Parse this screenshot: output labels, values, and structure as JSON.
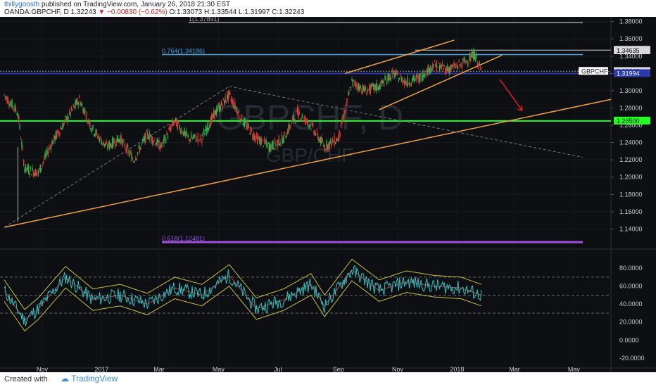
{
  "header": {
    "author": "thillygoosth",
    "published": "published on TradingView.com, January 26, 2018 21:30 EST",
    "symbol_line": "OANDA:GBPCHF, D  1.32243",
    "change": "−0.00830 (−0.62%)",
    "ohlc": "O:1.33073  H:1.33544  L:1.31997  C:1.32243"
  },
  "watermark": {
    "main": "GBPCHF, D",
    "sub": "GBP/CHF"
  },
  "colors": {
    "background": "#0d0f12",
    "bull": "#2db84a",
    "bear": "#e23a3a",
    "fib_blue": "#4a9fe0",
    "fib_gray": "#a0a0a0",
    "fib_purple": "#a050e0",
    "support_green": "#22ff22",
    "trend_orange": "#f0a040",
    "arrow_red": "#e02020",
    "rsi_line": "#30c0c0",
    "bands": "#c8c040"
  },
  "chart_data": {
    "type": "line",
    "title": "OANDA:GBPCHF, D",
    "price_axis": {
      "range": [
        1.12,
        1.383
      ],
      "ticks": [
        "1.38000",
        "1.36000",
        "1.34000",
        "1.32000",
        "1.30000",
        "1.28000",
        "1.26000",
        "1.24000",
        "1.22000",
        "1.20000",
        "1.18000",
        "1.16000",
        "1.14000"
      ]
    },
    "price_labels": [
      {
        "text": "1.34697",
        "value": 1.34697
      },
      {
        "text": "1.34635",
        "value": 1.34635
      },
      {
        "text": "GBPCHF",
        "value": 1.3225
      },
      {
        "text": "1.32243",
        "value": 1.32243
      },
      {
        "text": "1.31994",
        "value": 1.31994
      },
      {
        "text": "1.26500",
        "value": 1.265
      }
    ],
    "fib_levels": [
      {
        "label": "1(1.37891)",
        "value": 1.37891
      },
      {
        "label": "0.764(1.34186)",
        "value": 1.34186
      },
      {
        "label": "0.618(1.12481)",
        "value": 1.12481
      }
    ],
    "time_axis": [
      "Nov",
      "2017",
      "Mar",
      "May",
      "Jul",
      "Sep",
      "Nov",
      "2018",
      "Mar",
      "May"
    ],
    "series": [
      {
        "x": [
          "2016-09-23",
          "2016-10-07",
          "2016-10-14",
          "2016-10-28",
          "2016-11-11",
          "2016-11-25",
          "2016-12-09",
          "2016-12-23",
          "2017-01-06",
          "2017-01-20",
          "2017-02-03",
          "2017-02-17",
          "2017-03-03",
          "2017-03-17",
          "2017-03-31",
          "2017-04-14",
          "2017-04-28",
          "2017-05-12",
          "2017-05-26",
          "2017-06-09",
          "2017-06-23",
          "2017-07-07",
          "2017-07-21",
          "2017-08-04",
          "2017-08-18",
          "2017-09-01",
          "2017-09-15",
          "2017-09-29",
          "2017-10-13",
          "2017-10-27",
          "2017-11-10",
          "2017-11-24",
          "2017-12-08",
          "2017-12-22",
          "2018-01-05",
          "2018-01-19",
          "2018-01-26"
        ],
        "values": [
          1.295,
          1.275,
          1.21,
          1.205,
          1.24,
          1.265,
          1.29,
          1.255,
          1.235,
          1.245,
          1.22,
          1.25,
          1.235,
          1.265,
          1.245,
          1.245,
          1.275,
          1.295,
          1.265,
          1.245,
          1.235,
          1.245,
          1.275,
          1.26,
          1.235,
          1.245,
          1.31,
          1.3,
          1.305,
          1.32,
          1.31,
          1.315,
          1.33,
          1.325,
          1.33,
          1.342,
          1.32243
        ]
      }
    ],
    "rsi_axis": {
      "range": [
        -28,
        95
      ],
      "ticks": [
        "80.0000",
        "60.0000",
        "40.0000",
        "20.0000",
        "0.0000",
        "-20.0000"
      ],
      "guide_levels": [
        70,
        50,
        30
      ]
    },
    "rsi": {
      "x": [
        "2016-09-23",
        "2016-10-14",
        "2016-10-28",
        "2016-11-25",
        "2016-12-23",
        "2017-01-20",
        "2017-02-17",
        "2017-03-17",
        "2017-04-14",
        "2017-05-12",
        "2017-06-09",
        "2017-07-07",
        "2017-08-04",
        "2017-08-18",
        "2017-09-15",
        "2017-10-13",
        "2017-11-10",
        "2017-12-08",
        "2018-01-05",
        "2018-01-26"
      ],
      "values": [
        55,
        22,
        35,
        70,
        45,
        50,
        40,
        58,
        50,
        72,
        35,
        45,
        62,
        38,
        78,
        55,
        65,
        60,
        58,
        50
      ]
    }
  }
}
